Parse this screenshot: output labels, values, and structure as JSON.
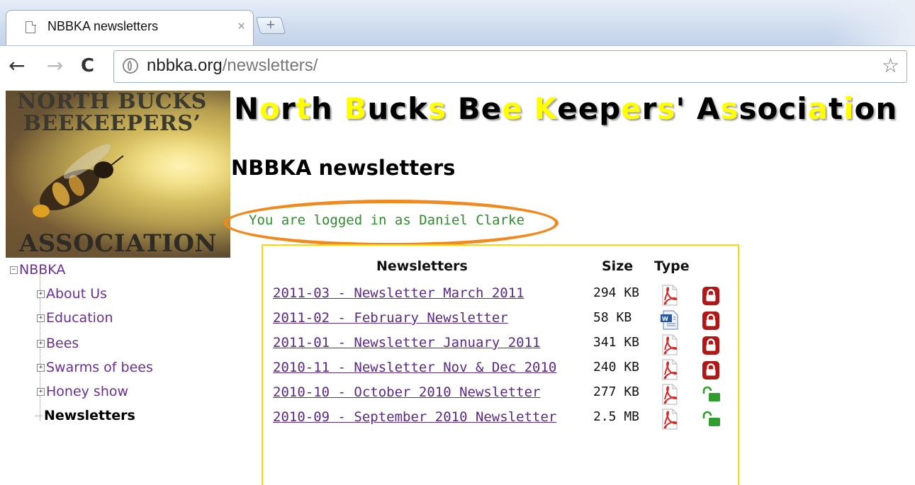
{
  "browser": {
    "tab_title": "NBBKA newsletters",
    "tab_close": "×",
    "new_tab": "+",
    "url_domain": "nbbka.org",
    "url_path": "/newsletters/",
    "back": "←",
    "forward": "→",
    "reload": "C",
    "star": "☆"
  },
  "logo": {
    "top_line1": "NORTH BUCKS",
    "top_line2": "BEEKEEPERS’",
    "bottom": "ASSOCIATION"
  },
  "site_title_parts": [
    "N",
    "o",
    "r",
    "t",
    "h",
    " ",
    "B",
    "u",
    "c",
    "k",
    "s",
    " ",
    "B",
    "e",
    "e",
    " ",
    "K",
    "e",
    "e",
    "p",
    "e",
    "r",
    "s",
    "'",
    " ",
    "A",
    "s",
    "s",
    "o",
    "c",
    "i",
    "a",
    "t",
    "i",
    "o",
    "n"
  ],
  "page_title": "NBBKA newsletters",
  "login_status": "You are logged in as Daniel Clarke",
  "nav": {
    "root": "NBBKA",
    "items": [
      {
        "label": "About Us",
        "expand": "+"
      },
      {
        "label": "Education",
        "expand": "+"
      },
      {
        "label": "Bees",
        "expand": "+"
      },
      {
        "label": "Swarms of bees",
        "expand": "+"
      },
      {
        "label": "Honey show",
        "expand": "+"
      }
    ],
    "current": "Newsletters"
  },
  "table": {
    "headers": {
      "name": "Newsletters",
      "size": "Size",
      "type": "Type"
    },
    "rows": [
      {
        "title": "2011-03 - Newsletter March 2011",
        "size": "294 KB",
        "type": "pdf",
        "lock": "locked"
      },
      {
        "title": "2011-02 - February Newsletter",
        "size": "58 KB",
        "type": "word",
        "lock": "locked"
      },
      {
        "title": "2011-01 - Newsletter January 2011",
        "size": "341 KB",
        "type": "pdf",
        "lock": "locked"
      },
      {
        "title": "2010-11 - Newsletter Nov & Dec 2010",
        "size": "240 KB",
        "type": "pdf",
        "lock": "locked"
      },
      {
        "title": "2010-10 - October 2010 Newsletter",
        "size": "277 KB",
        "type": "pdf",
        "lock": "unlocked"
      },
      {
        "title": "2010-09 - September 2010 Newsletter",
        "size": "2.5 MB",
        "type": "pdf",
        "lock": "unlocked"
      }
    ]
  },
  "colors": {
    "link": "#5b2a82",
    "login_text": "#2e8b2e",
    "highlight_oval": "#f08a1e",
    "box_border": "#ffd60a",
    "title_highlight": "#ffff00",
    "lock_red": "#b01818",
    "unlock_green": "#2f9e2f"
  },
  "icons": {
    "type_pdf": "pdf-file-icon",
    "type_word": "word-file-icon",
    "locked": "padlock-locked-icon",
    "unlocked": "padlock-unlocked-icon"
  }
}
